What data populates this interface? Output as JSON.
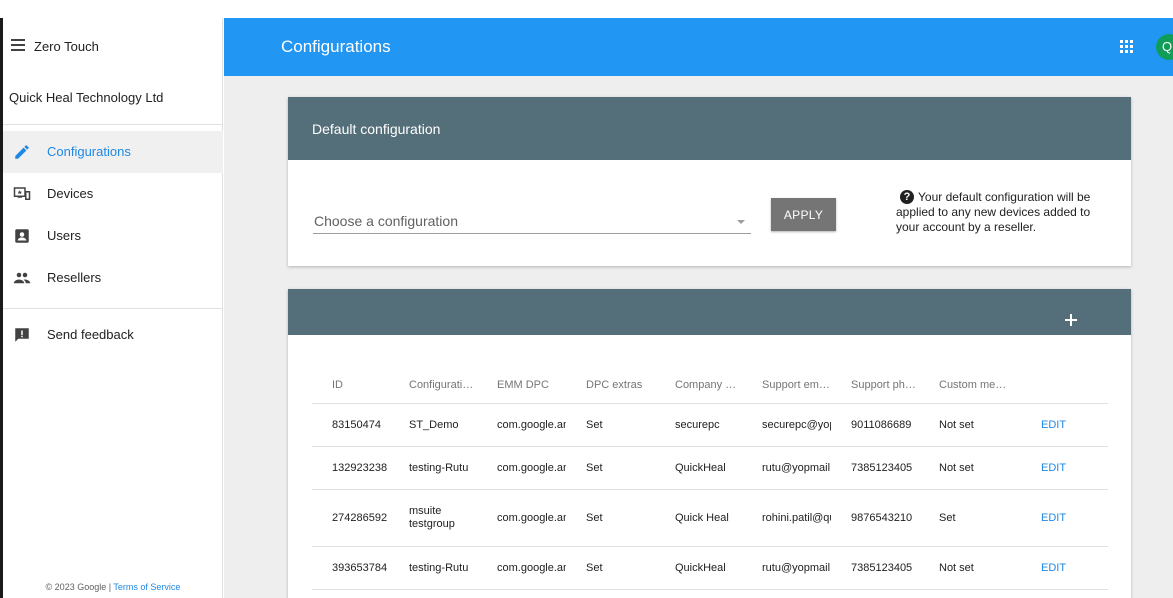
{
  "sidebar": {
    "app_title": "Zero Touch",
    "org_name": "Quick Heal Technology Ltd",
    "items": [
      {
        "label": "Configurations",
        "icon": "pencil-icon"
      },
      {
        "label": "Devices",
        "icon": "devices-icon"
      },
      {
        "label": "Users",
        "icon": "user-badge-icon"
      },
      {
        "label": "Resellers",
        "icon": "people-icon"
      }
    ],
    "feedback_label": "Send feedback",
    "footer_copyright": "© 2023 Google | ",
    "footer_link": "Terms of Service"
  },
  "header": {
    "title": "Configurations",
    "avatar_letter": "Q"
  },
  "default_config": {
    "title": "Default configuration",
    "select_placeholder": "Choose a configuration",
    "apply_label": "APPLY",
    "help_text": "Your default configuration will be applied to any new devices added to your account by a reseller."
  },
  "config_table": {
    "add_icon": "plus-icon",
    "columns": [
      "ID",
      "Configuratio…",
      "EMM DPC",
      "DPC extras",
      "Company na…",
      "Support em…",
      "Support pho…",
      "Custom me…",
      ""
    ],
    "rows": [
      {
        "id": "83150474",
        "name": "ST_Demo",
        "emm": "com.google.an",
        "extras": "Set",
        "company": "securepc",
        "email": "securepc@yopı",
        "phone": "9011086689",
        "custom": "Not set",
        "action": "EDIT"
      },
      {
        "id": "132923238",
        "name": "testing-Rutu",
        "emm": "com.google.an",
        "extras": "Set",
        "company": "QuickHeal",
        "email": "rutu@yopmail.c",
        "phone": "7385123405",
        "custom": "Not set",
        "action": "EDIT"
      },
      {
        "id": "274286592",
        "name": "msuite testgroup",
        "emm": "com.google.an",
        "extras": "Set",
        "company": "Quick Heal",
        "email": "rohini.patil@qu",
        "phone": "9876543210",
        "custom": "Set",
        "action": "EDIT"
      },
      {
        "id": "393653784",
        "name": "testing-Rutu",
        "emm": "com.google.an",
        "extras": "Set",
        "company": "QuickHeal",
        "email": "rutu@yopmail.c",
        "phone": "7385123405",
        "custom": "Not set",
        "action": "EDIT"
      }
    ]
  },
  "colors": {
    "appbar": "#2196f3",
    "card_header": "#546e7a",
    "accent": "#1e88e5",
    "avatar": "#0f9d58",
    "apply_button": "#757575"
  }
}
